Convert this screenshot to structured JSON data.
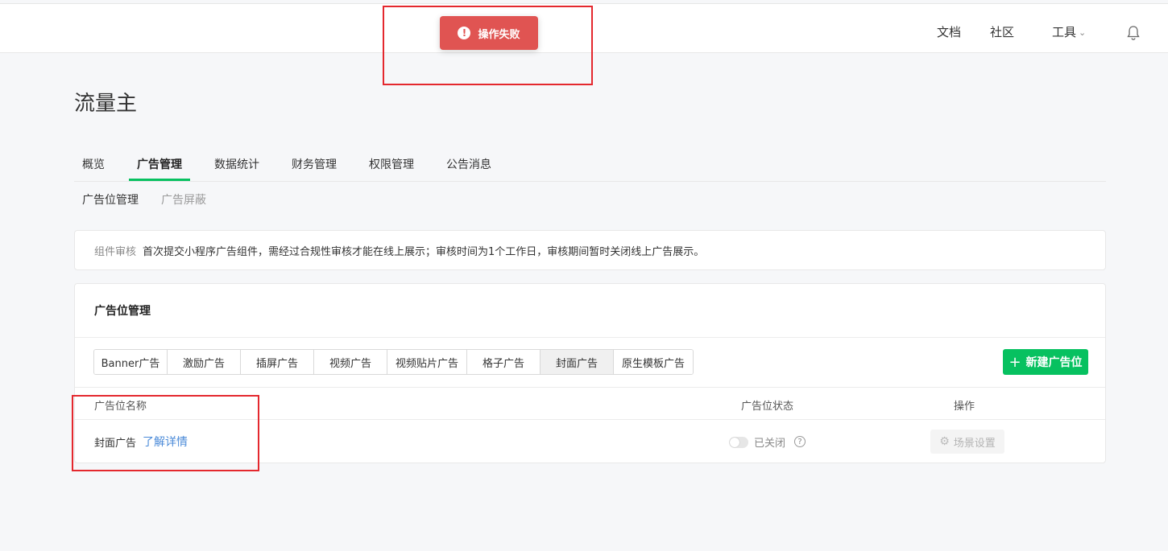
{
  "toast": {
    "message": "操作失败",
    "icon": "exclamation-icon",
    "color": "#e05452"
  },
  "topnav": {
    "docs": "文档",
    "community": "社区",
    "tools": "工具"
  },
  "page": {
    "title": "流量主"
  },
  "tabs": [
    {
      "label": "概览"
    },
    {
      "label": "广告管理",
      "active": true
    },
    {
      "label": "数据统计"
    },
    {
      "label": "财务管理"
    },
    {
      "label": "权限管理"
    },
    {
      "label": "公告消息"
    }
  ],
  "subtabs": [
    {
      "label": "广告位管理",
      "active": true
    },
    {
      "label": "广告屏蔽"
    }
  ],
  "notice": {
    "label": "组件审核",
    "text": "首次提交小程序广告组件，需经过合规性审核才能在线上展示；审核时间为1个工作日，审核期间暂时关闭线上广告展示。"
  },
  "panel": {
    "title": "广告位管理",
    "types": [
      {
        "label": "Banner广告"
      },
      {
        "label": "激励广告"
      },
      {
        "label": "插屏广告"
      },
      {
        "label": "视频广告"
      },
      {
        "label": "视频贴片广告"
      },
      {
        "label": "格子广告"
      },
      {
        "label": "封面广告",
        "active": true
      },
      {
        "label": "原生模板广告"
      }
    ],
    "new_button": "新建广告位",
    "columns": {
      "name": "广告位名称",
      "status": "广告位状态",
      "action": "操作"
    },
    "rows": [
      {
        "name": "封面广告",
        "link": "了解详情",
        "status": "已关闭",
        "action": "场景设置"
      }
    ]
  },
  "colors": {
    "accent": "#07c160",
    "link": "#4a8ad8",
    "annotation": "#e4282e"
  }
}
